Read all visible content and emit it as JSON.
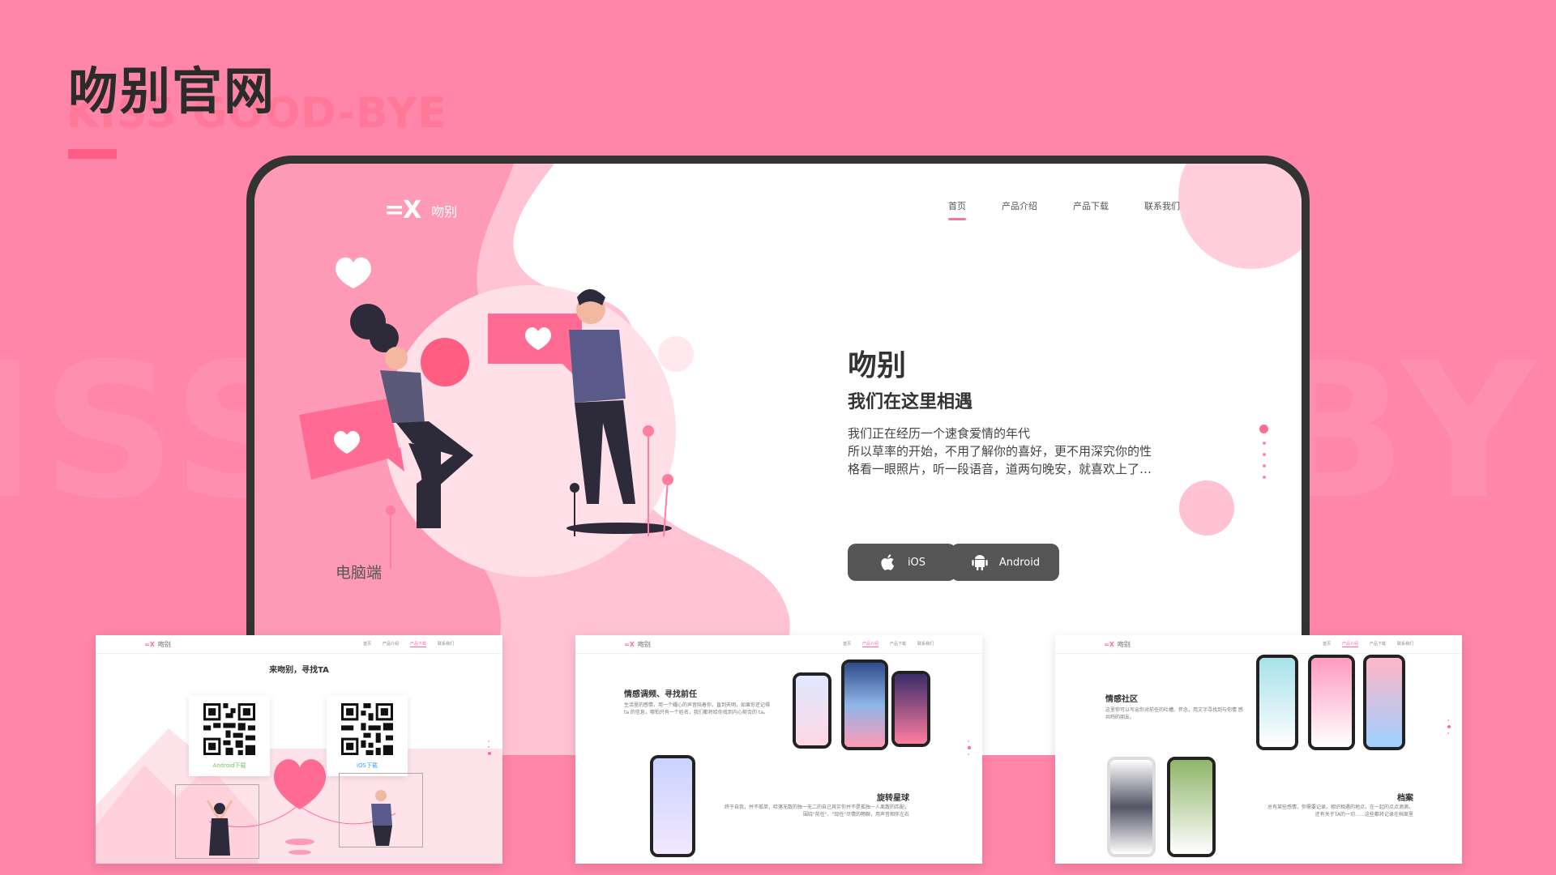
{
  "page": {
    "title": "吻别官网",
    "subtitle": "KISS GOOD-BYE",
    "bg_left": "ISS",
    "bg_right": "BYE",
    "label_pc": "电脑端"
  },
  "site": {
    "logo_mark": "=X",
    "logo_text": "吻别",
    "nav": [
      "首页",
      "产品介绍",
      "产品下载",
      "联系我们"
    ],
    "hero_title": "吻别",
    "hero_subtitle": "我们在这里相遇",
    "hero_desc": [
      "我们正在经历一个速食爱情的年代",
      "所以草率的开始，不用了解你的喜好，更不用深究你的性",
      "格看一眼照片，听一段语音，道两句晚安，就喜欢上了…"
    ],
    "btn_ios": "iOS",
    "btn_android": "Android"
  },
  "download_card": {
    "heading": "来吻别，寻找TA",
    "android_label": "Android下载",
    "ios_label": "iOS下载"
  },
  "feature_card": {
    "heading1": "情感调频、寻找前任",
    "text1": "生活里的感情，用一个耀心的声音陪着你，直到天明，如果你还记得 ta 的信息，哪怕只有一个姓名，我们都将给你找到内心契合的 ta。",
    "heading2": "旋转星球",
    "text2": "终于自我，并不孤单，哈落无数的独一无二的自己其实你并不是孤独一人离散的匹配，围绕\"前任\"、\"现任\"尽情的畅聊，用声音相伴左右"
  },
  "community_card": {
    "heading1": "情感社区",
    "text1": "这里你可以写出你对前任的吐槽、怀念，用文字寻找到与你情 感共鸣的朋友。",
    "heading2": "档案",
    "text2": "总有某些感情，你需要记录。相识相遇的地点，在一起的点点滴滴，还有关于TA的一切……这些都将记录在档案里"
  },
  "colors": {
    "background": "#ff86a8",
    "accent": "#ff6b93",
    "dark": "#333333"
  }
}
